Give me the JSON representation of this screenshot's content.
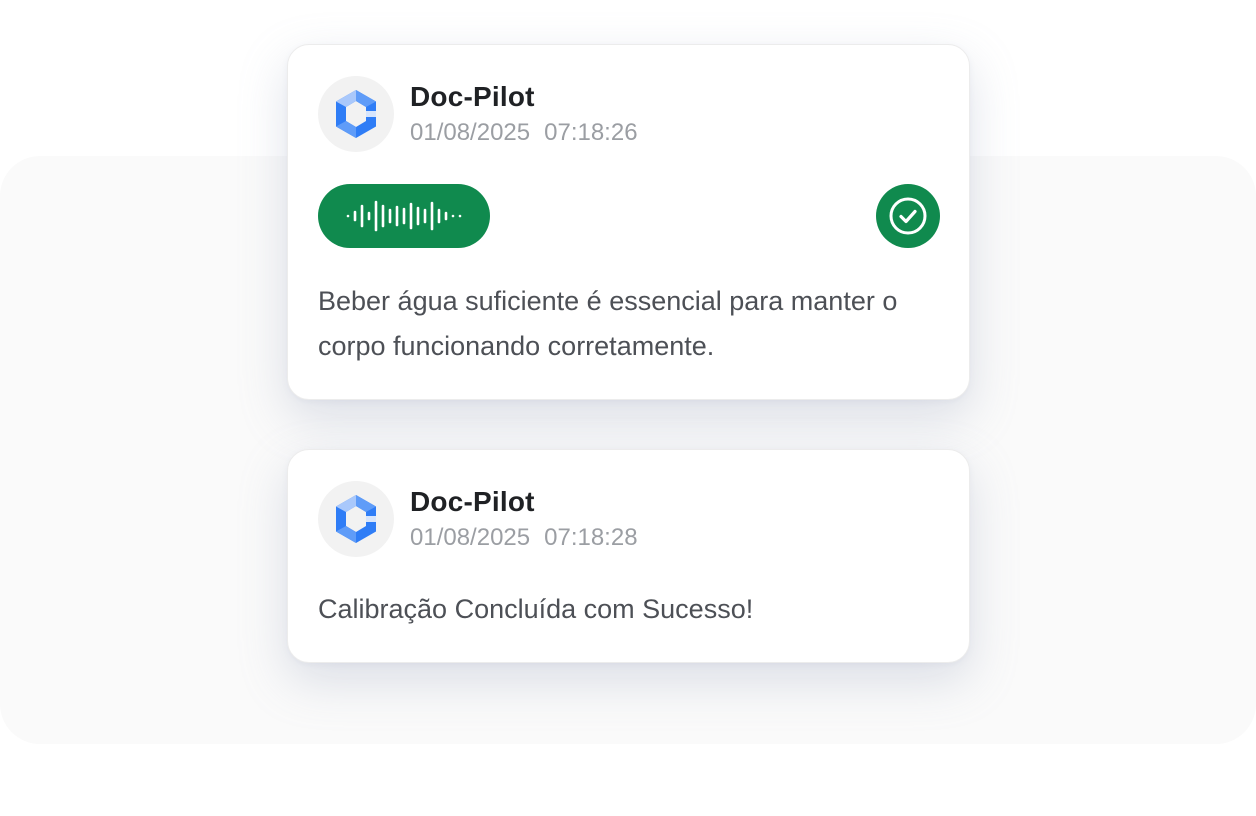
{
  "messages": [
    {
      "sender": "Doc-Pilot",
      "date": "01/08/2025",
      "time": "07:18:26",
      "avatar_icon": "doc-pilot-logo-icon",
      "attachment": {
        "type": "audio",
        "icon": "waveform-icon",
        "color": "#108a4e"
      },
      "status_icon": "check-circle-icon",
      "text": "Beber água suficiente é essencial para manter o corpo funcionando corretamente."
    },
    {
      "sender": "Doc-Pilot",
      "date": "01/08/2025",
      "time": "07:18:28",
      "avatar_icon": "doc-pilot-logo-icon",
      "text": "Calibração Concluída com Sucesso!"
    }
  ],
  "colors": {
    "accent": "#108a4e",
    "logo_blue": "#2f7df6",
    "logo_light": "#a9c8fb"
  }
}
